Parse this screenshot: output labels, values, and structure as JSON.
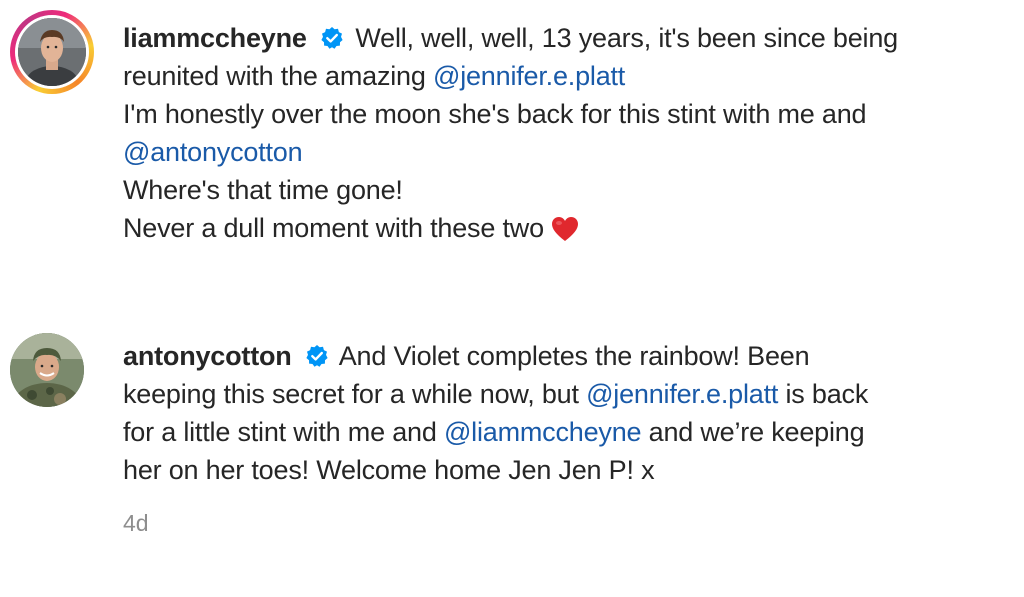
{
  "comments": [
    {
      "username": "liammccheyne",
      "verified": true,
      "avatar_icon": "profile-photo-young-man",
      "story_ring": true,
      "lines": [
        {
          "segments": [
            {
              "type": "text",
              "text": "Well, well, well, 13 years, it's been since being"
            }
          ]
        },
        {
          "segments": [
            {
              "type": "text",
              "text": "reunited with the amazing "
            },
            {
              "type": "mention",
              "text": "@jennifer.e.platt"
            }
          ]
        },
        {
          "segments": [
            {
              "type": "text",
              "text": "I'm honestly over the moon she's back for this stint with me and"
            }
          ]
        },
        {
          "segments": [
            {
              "type": "mention",
              "text": "@antonycotton"
            }
          ]
        },
        {
          "segments": [
            {
              "type": "text",
              "text": "Where's that time gone!"
            }
          ]
        },
        {
          "segments": [
            {
              "type": "text",
              "text": "Never a dull moment with these two"
            }
          ]
        }
      ],
      "emoji": "red-heart-icon"
    },
    {
      "username": "antonycotton",
      "verified": true,
      "avatar_icon": "profile-photo-man-in-camouflage",
      "story_ring": false,
      "lines": [
        {
          "segments": [
            {
              "type": "text",
              "text": "And Violet completes the rainbow! Been"
            }
          ]
        },
        {
          "segments": [
            {
              "type": "text",
              "text": "keeping this secret for a while now, but "
            },
            {
              "type": "mention",
              "text": "@jennifer.e.platt"
            },
            {
              "type": "text",
              "text": " is back"
            }
          ]
        },
        {
          "segments": [
            {
              "type": "text",
              "text": "for a little stint with me and "
            },
            {
              "type": "mention",
              "text": "@liammccheyne"
            },
            {
              "type": "text",
              "text": " and we’re keeping"
            }
          ]
        },
        {
          "segments": [
            {
              "type": "text",
              "text": "her on her toes! Welcome home Jen Jen P! x"
            }
          ]
        }
      ],
      "timestamp": "4d"
    }
  ],
  "colors": {
    "text": "#262626",
    "mention": "#1a5aa8",
    "verified_badge": "#0095f6",
    "timestamp": "#8e8e8e",
    "heart": "#e0282e"
  }
}
